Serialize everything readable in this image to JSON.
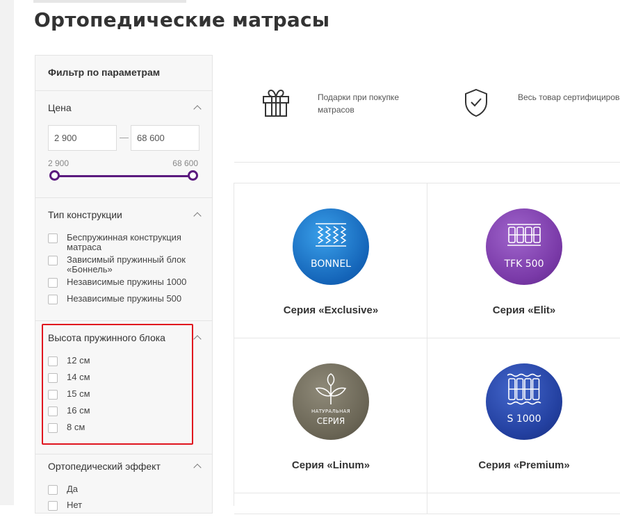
{
  "page": {
    "title": "Ортопедические матрасы"
  },
  "filter": {
    "title": "Фильтр по параметрам",
    "price": {
      "title": "Цена",
      "min_value": "2 900",
      "max_value": "68 600",
      "range_min_label": "2 900",
      "range_max_label": "68 600",
      "selected_fraction": [
        0,
        1
      ]
    },
    "construction": {
      "title": "Тип конструкции",
      "options": [
        "Беспружинная конструкция матраса",
        "Зависимый пружинный блок «Боннель»",
        "Независимые пружины 1000",
        "Независимые пружины 500"
      ]
    },
    "spring_height": {
      "title": "Высота пружинного блока",
      "options": [
        "12 см",
        "14 см",
        "15 см",
        "16 см",
        "8 см"
      ]
    },
    "ortho_effect": {
      "title": "Ортопедический эффект",
      "options": [
        "Да",
        "Нет"
      ]
    }
  },
  "benefits": [
    {
      "icon": "gift-icon",
      "text": "Подарки при покупке матрасов"
    },
    {
      "icon": "shield-check-icon",
      "text": "Весь товар сертифицирован"
    }
  ],
  "series": [
    {
      "title": "Серия «Exclusive»",
      "badge": "BONNEL",
      "color": "#1673c9",
      "icon": "spring-block-icon"
    },
    {
      "title": "Серия «Elit»",
      "badge": "TFK 500",
      "color": "#7a3aa8",
      "icon": "pocket-spring-icon"
    },
    {
      "title": "Серия «Linum»",
      "badge_line1": "НАТУРАЛЬНАЯ",
      "badge_line2": "СЕРИЯ",
      "color": "#6e6a5c",
      "icon": "leaf-icon"
    },
    {
      "title": "Серия «Premium»",
      "badge": "S 1000",
      "color": "#2340a0",
      "icon": "pocket-spring-icon"
    }
  ],
  "colors": {
    "accent": "#5b1a7e",
    "highlight": "#e0141e"
  }
}
